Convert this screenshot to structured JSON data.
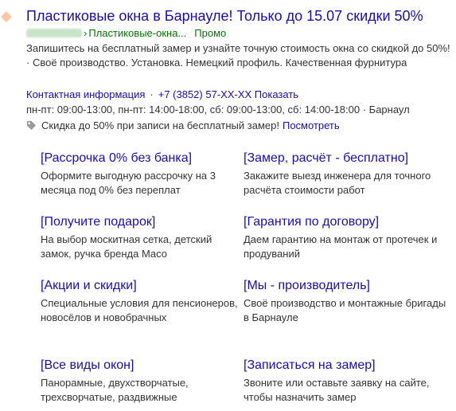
{
  "ad": {
    "favicon_icon": "brand-diamond-icon",
    "title": "Пластиковые окна в Барнауле! Только до 15.07 скидки 50%",
    "url_separator": "›",
    "url_path": "Пластиковые-окна...",
    "promo_label": "Промо",
    "description": "Запишитесь на бесплатный замер и узнайте точную стоимость окна со скидкой до 50%! · Своё производство. Установка. Немецкий профиль. Качественная фурнитура",
    "contacts": {
      "info_link": "Контактная информация",
      "phone": "+7 (3852) 57-XX-XX",
      "show_link": "Показать"
    },
    "hours": "пн-пт: 09:00-13:00, пн-пт: 14:00-18:00, сб: 09:00-13:00, сб: 14:00-18:00 · Барнаул",
    "promo_offer": {
      "icon": "tag-icon",
      "text": "Скидка до 50% при записи на бесплатный замер!",
      "link": "Посмотреть"
    },
    "sitelinks": [
      {
        "title": "[Рассрочка 0% без банка]",
        "description": "Оформите выгодную рассрочку на 3 месяца под 0% без переплат"
      },
      {
        "title": "[Замер, расчёт - бесплатно]",
        "description": "Закажите выезд инженера для точного расчёта стоимости работ"
      },
      {
        "title": "[Получите подарок]",
        "description": "На выбор москитная сетка, детский замок, ручка бренда Масо"
      },
      {
        "title": "[Гарантия по договору]",
        "description": "Даем гарантию на монтаж от протечек и продуваний"
      },
      {
        "title": "[Акции и скидки]",
        "description": "Специальные условия для пенсионеров, новосёлов и новобрачных"
      },
      {
        "title": "[Мы - производитель]",
        "description": "Своё производство и монтажные бригады в Барнауле"
      },
      {
        "title": "[Все виды окон]",
        "description": "Панорамные, двухстворчатые, трехсворчатые, раздвижные"
      },
      {
        "title": "[Записаться на замер]",
        "description": "Звоните или оставьте заявку на сайте, чтобы назначить замер"
      }
    ]
  }
}
